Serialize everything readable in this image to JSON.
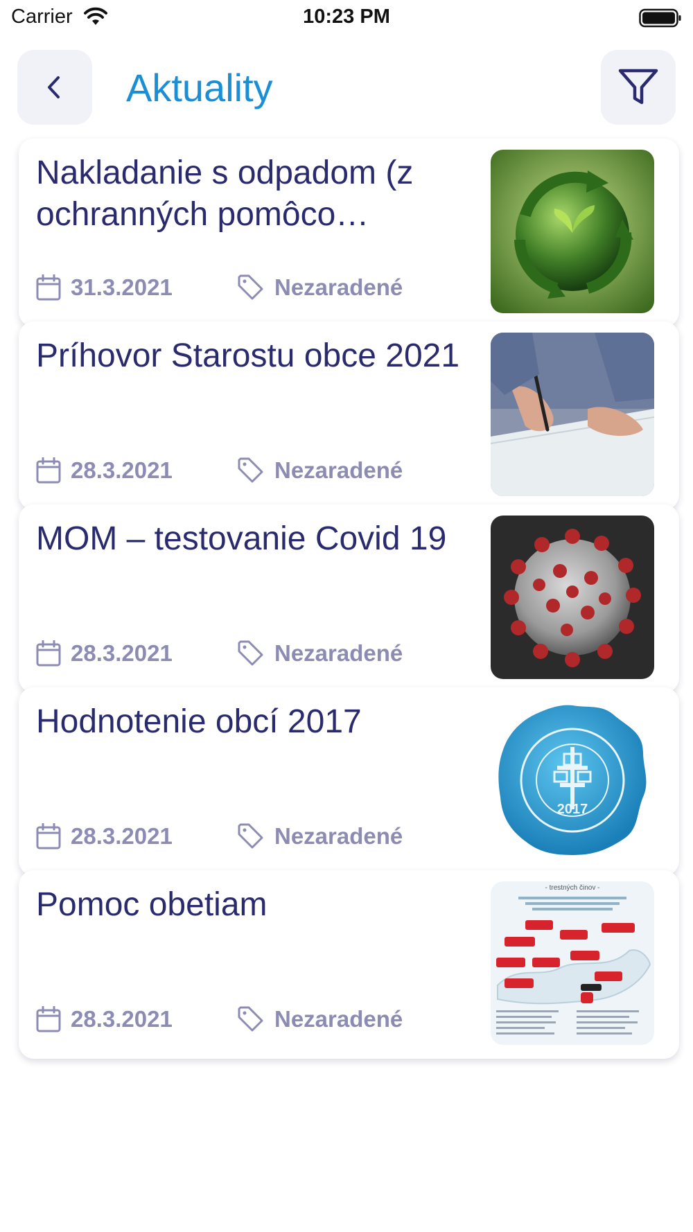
{
  "status_bar": {
    "carrier": "Carrier",
    "time": "10:23 PM"
  },
  "header": {
    "title": "Aktuality",
    "back_icon": "chevron-left-icon",
    "filter_icon": "filter-icon"
  },
  "colors": {
    "title": "#1a8fd6",
    "text": "#2a2a6e",
    "meta": "#8c8bb4",
    "button_bg": "#f1f1f8"
  },
  "articles": [
    {
      "title": "Nakladanie s odpadom (z ochranných pomôco…",
      "date": "31.3.2021",
      "category": "Nezaradené",
      "image": "recycling-earth-image"
    },
    {
      "title": "Príhovor Starostu obce 2021",
      "date": "28.3.2021",
      "category": "Nezaradené",
      "image": "writing-hand-image"
    },
    {
      "title": "MOM – testovanie Covid 19",
      "date": "28.3.2021",
      "category": "Nezaradené",
      "image": "coronavirus-image"
    },
    {
      "title": "Hodnotenie obcí 2017",
      "date": "28.3.2021",
      "category": "Nezaradené",
      "image": "award-seal-image",
      "seal_text": "PEČAŤ ROZVOJA OBCÍ A MIEST 2017"
    },
    {
      "title": "Pomoc obetiam",
      "date": "28.3.2021",
      "category": "Nezaradené",
      "image": "victims-help-map-image",
      "poster_heading": "- trestných činov -"
    }
  ]
}
